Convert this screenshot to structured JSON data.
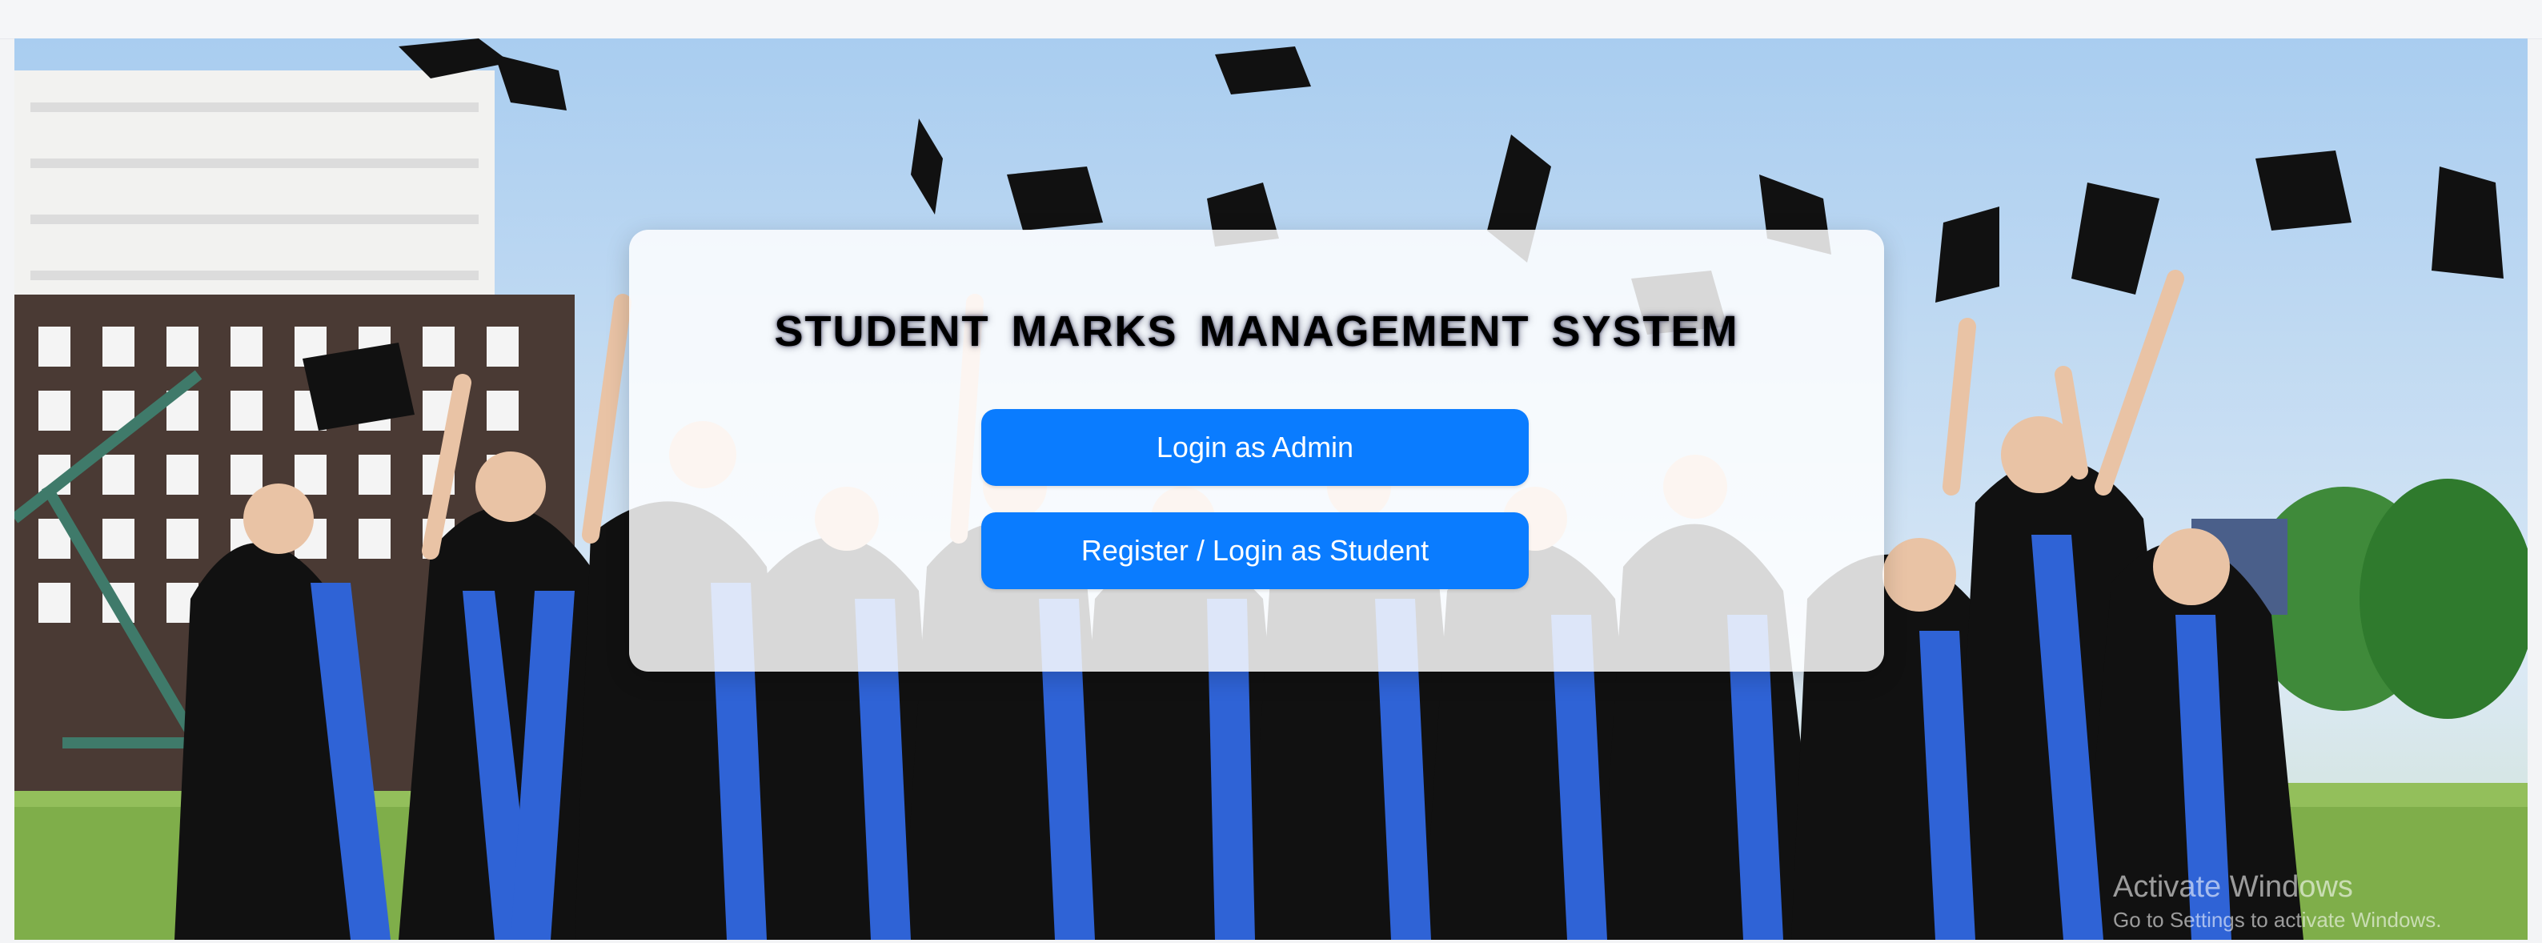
{
  "app": {
    "title": "STUDENT MARKS MANAGEMENT SYSTEM"
  },
  "actions": {
    "admin_label": "Login as Admin",
    "student_label": "Register / Login as Student"
  },
  "watermark": {
    "line1": "Activate Windows",
    "line2": "Go to Settings to activate Windows."
  },
  "colors": {
    "button": "#0a7cff",
    "gown": "#111111",
    "stole": "#2f63d6"
  },
  "background": {
    "subject": "graduates throwing caps",
    "cap-icon": "mortarboard"
  }
}
